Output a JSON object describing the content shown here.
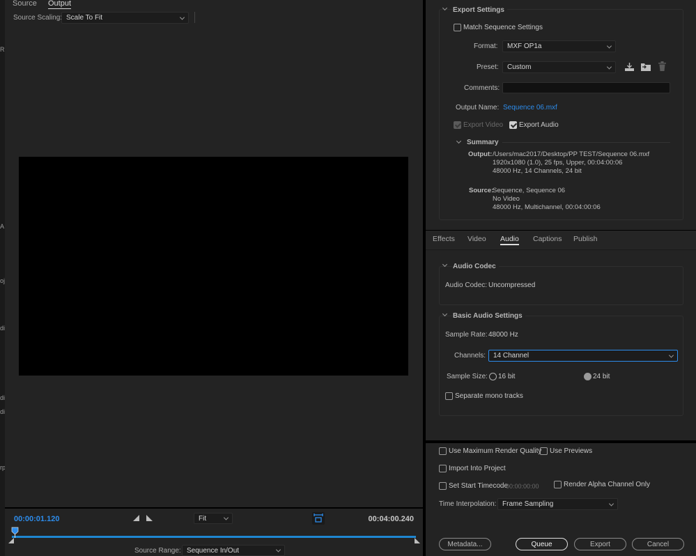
{
  "left_strip": {
    "fragments": [
      "R",
      "A",
      "oj",
      "di",
      "di",
      "di",
      "rp"
    ]
  },
  "source_panel": {
    "tabs": [
      {
        "label": "Source",
        "active": false
      },
      {
        "label": "Output",
        "active": true
      }
    ],
    "source_scaling": {
      "label": "Source Scaling:",
      "value": "Scale To Fit"
    }
  },
  "timeline": {
    "current_time": "00:00:01.120",
    "duration": "00:04:00.240",
    "zoom": "Fit",
    "playhead_position": 0.0,
    "source_range": {
      "label": "Source Range:",
      "value": "Sequence In/Out"
    },
    "accent_color": "#2d8ceb"
  },
  "export_settings": {
    "title": "Export Settings",
    "match_sequence": {
      "label": "Match Sequence Settings",
      "checked": false
    },
    "format": {
      "label": "Format:",
      "value": "MXF OP1a"
    },
    "preset": {
      "label": "Preset:",
      "value": "Custom"
    },
    "preset_icons": [
      "save-preset-icon",
      "import-preset-icon",
      "delete-preset-icon"
    ],
    "comments": {
      "label": "Comments:",
      "value": ""
    },
    "output_name": {
      "label": "Output Name:",
      "value": "Sequence 06.mxf"
    },
    "export_video": {
      "label": "Export Video",
      "checked": true,
      "disabled": true
    },
    "export_audio": {
      "label": "Export Audio",
      "checked": true
    },
    "summary": {
      "title": "Summary",
      "output_label": "Output:",
      "output_lines": [
        "/Users/mac2017/Desktop/PP TEST/Sequence 06.mxf",
        "1920x1080 (1.0), 25 fps, Upper, 00:04:00:06",
        "48000 Hz, 14 Channels, 24 bit"
      ],
      "source_label": "Source:",
      "source_lines": [
        "Sequence, Sequence 06",
        "No Video",
        "48000 Hz, Multichannel, 00:04:00:06"
      ]
    }
  },
  "tabs": [
    {
      "label": "Effects",
      "active": false
    },
    {
      "label": "Video",
      "active": false
    },
    {
      "label": "Audio",
      "active": true
    },
    {
      "label": "Captions",
      "active": false
    },
    {
      "label": "Publish",
      "active": false
    }
  ],
  "audio_codec": {
    "title": "Audio Codec",
    "label": "Audio Codec:",
    "value": "Uncompressed"
  },
  "basic_audio": {
    "title": "Basic Audio Settings",
    "sample_rate": {
      "label": "Sample Rate:",
      "value": "48000 Hz"
    },
    "channels": {
      "label": "Channels:",
      "value": "14 Channel"
    },
    "sample_size": {
      "label": "Sample Size:",
      "options": [
        {
          "label": "16 bit",
          "selected": false
        },
        {
          "label": "24 bit",
          "selected": true
        }
      ]
    },
    "separate_mono": {
      "label": "Separate mono tracks",
      "checked": false
    }
  },
  "render_options": {
    "max_render_quality": {
      "label": "Use Maximum Render Quality",
      "checked": false
    },
    "use_previews": {
      "label": "Use Previews",
      "checked": false
    },
    "import_into_project": {
      "label": "Import Into Project",
      "checked": false
    },
    "set_start_timecode": {
      "label": "Set Start Timecode",
      "checked": false,
      "value": "00:00:00:00"
    },
    "render_alpha": {
      "label": "Render Alpha Channel Only",
      "checked": false
    },
    "time_interpolation": {
      "label": "Time Interpolation:",
      "value": "Frame Sampling"
    }
  },
  "buttons": {
    "metadata": "Metadata...",
    "queue": "Queue",
    "export": "Export",
    "cancel": "Cancel"
  }
}
